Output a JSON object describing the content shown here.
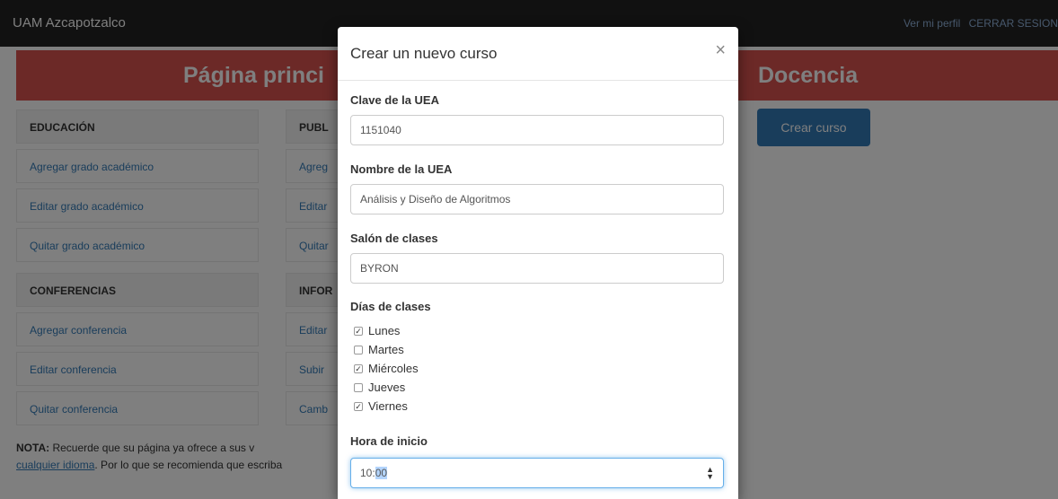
{
  "navbar": {
    "brand": "UAM Azcapotzalco",
    "profile_link": "Ver mi perfil",
    "logout_link": "CERRAR SESION"
  },
  "header": {
    "left_title": "Página princi",
    "right_title": "Docencia"
  },
  "menu": {
    "educacion": {
      "title": "EDUCACIÓN",
      "items": [
        "Agregar grado académico",
        "Editar grado académico",
        "Quitar grado académico"
      ]
    },
    "publicaciones": {
      "title": "PUBL",
      "items": [
        "Agreg",
        "Editar",
        "Quitar"
      ]
    },
    "conferencias": {
      "title": "CONFERENCIAS",
      "items": [
        "Agregar conferencia",
        "Editar conferencia",
        "Quitar conferencia"
      ]
    },
    "informacion": {
      "title": "INFOR",
      "items": [
        "Editar",
        "Subir",
        "Camb"
      ]
    }
  },
  "create_button": "Crear curso",
  "note": {
    "prefix": "NOTA:",
    "line1": " Recuerde que su página ya ofrece a sus v",
    "link": "cualquier idioma",
    "line2": ". Por lo que se recomienda que escriba"
  },
  "modal": {
    "title": "Crear un nuevo curso",
    "close": "×",
    "clave_label": "Clave de la UEA",
    "clave_value": "1151040",
    "nombre_label": "Nombre de la UEA",
    "nombre_value": "Análisis y Diseño de Algoritmos",
    "salon_label": "Salón de clases",
    "salon_value": "BYRON",
    "dias_label": "Días de clases",
    "days": [
      {
        "label": "Lunes",
        "checked": true
      },
      {
        "label": "Martes",
        "checked": false
      },
      {
        "label": "Miércoles",
        "checked": true
      },
      {
        "label": "Jueves",
        "checked": false
      },
      {
        "label": "Viernes",
        "checked": true
      }
    ],
    "hora_label": "Hora de inicio",
    "hora_value_prefix": "10:",
    "hora_value_selected": "00"
  },
  "icons": {
    "close": "close-icon",
    "spinner": "spinner-arrows-icon"
  },
  "colors": {
    "header_red": "#d9534f",
    "primary_blue": "#337ab7",
    "navbar": "#222222"
  }
}
